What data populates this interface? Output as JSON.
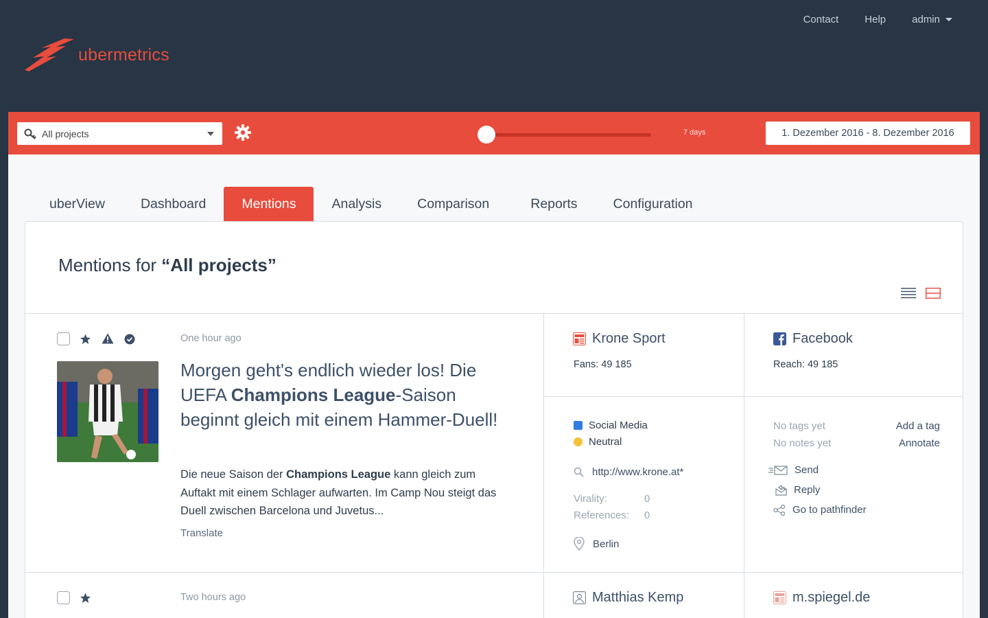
{
  "top_nav": {
    "contact": "Contact",
    "help": "Help",
    "user": "admin"
  },
  "brand": {
    "name": "ubermetrics",
    "color": "#e84c3d"
  },
  "toolbar": {
    "project_select": "All projects",
    "slider_label": "7 days",
    "date_range": "1. Dezember 2016 - 8. Dezember 2016"
  },
  "tabs": [
    "uberView",
    "Dashboard",
    "Mentions",
    "Analysis",
    "Comparison",
    "Reports",
    "Configuration"
  ],
  "active_tab": "Mentions",
  "page": {
    "title_prefix": "Mentions for ",
    "title_quoted": "“All projects”"
  },
  "mentions": [
    {
      "time": "One hour ago",
      "headline_p1": "Morgen geht's endlich wieder los! Die UEFA ",
      "headline_bold": "Champions League",
      "headline_p2": "-Saison beginnt gleich mit einem Hammer-Duell!",
      "snippet_p1": "Die neue Saison der ",
      "snippet_bold": "Champions League",
      "snippet_p2": " kann gleich zum Auftakt mit einem Schlager aufwarten. Im Camp Nou steigt das Duell zwischen Barcelona und Juvetus...",
      "translate": "Translate",
      "source": {
        "name": "Krone Sport",
        "fans": "Fans: 49 185"
      },
      "channel": {
        "name": "Facebook",
        "reach": "Reach: 49 185"
      },
      "media_type": "Social Media",
      "sentiment": "Neutral",
      "url": "http://www.krone.at*",
      "virality_label": "Virality:",
      "virality": "0",
      "references_label": "References:",
      "references": "0",
      "location": "Berlin",
      "tags": "No tags yet",
      "add_tag": "Add a tag",
      "notes": "No notes yet",
      "annotate": "Annotate",
      "actions": {
        "send": "Send",
        "reply": "Reply",
        "pathfinder": "Go to pathfinder"
      }
    },
    {
      "time": "Two hours ago",
      "source": {
        "name": "Matthias Kemp"
      },
      "channel": {
        "name": "m.spiegel.de"
      }
    }
  ],
  "colors": {
    "header_bg": "#273544",
    "accent": "#e84c3d",
    "social_media": "#2f7de1",
    "neutral": "#f3c13a",
    "facebook": "#3b5998"
  }
}
